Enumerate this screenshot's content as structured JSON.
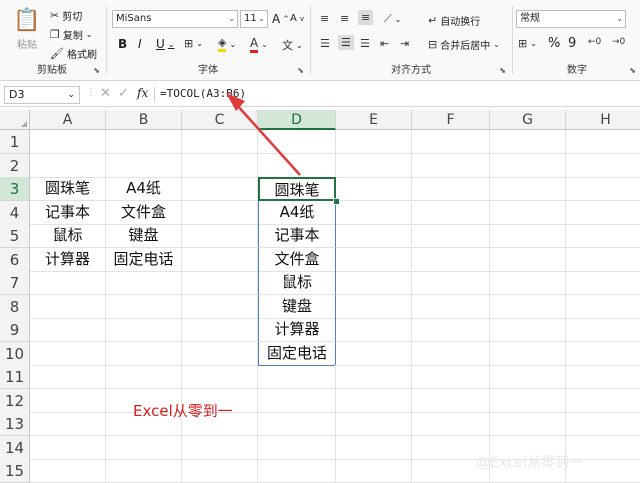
{
  "ribbon": {
    "clipboard": {
      "paste": "粘贴",
      "cut": "剪切",
      "copy": "复制",
      "format_painter": "格式刷",
      "group": "剪贴板"
    },
    "font": {
      "name": "MiSans",
      "size": "11",
      "bold": "B",
      "italic": "I",
      "underline": "U",
      "grow": "A",
      "shrink": "A",
      "color_letter": "A",
      "group": "字体"
    },
    "alignment": {
      "wrap": "自动换行",
      "merge": "合并后居中",
      "group": "对齐方式"
    },
    "number": {
      "format": "常规",
      "percent": "%",
      "comma": "9",
      "group": "数字"
    }
  },
  "formula_bar": {
    "name_box": "D3",
    "fx": "fx",
    "formula": "=TOCOL(A3:B6)"
  },
  "sheet": {
    "columns": [
      "A",
      "B",
      "C",
      "D",
      "E",
      "F",
      "G",
      "H"
    ],
    "selected_column": "D",
    "rows": [
      "1",
      "2",
      "3",
      "4",
      "5",
      "6",
      "7",
      "8",
      "9",
      "10",
      "11",
      "12",
      "13",
      "14",
      "15"
    ],
    "selected_row": "3",
    "col_a": [
      "圆珠笔",
      "记事本",
      "鼠标",
      "计算器"
    ],
    "col_b": [
      "A4纸",
      "文件盒",
      "键盘",
      "固定电话"
    ],
    "col_d": [
      "圆珠笔",
      "A4纸",
      "记事本",
      "文件盒",
      "鼠标",
      "键盘",
      "计算器",
      "固定电话"
    ]
  },
  "annotation": "Excel从零到一",
  "watermark": "@Excel从零到一",
  "colors": {
    "accent": "#217346",
    "arrow": "#e03a3a",
    "annotation": "#d11f1f",
    "spill_border": "#4f81bd"
  }
}
